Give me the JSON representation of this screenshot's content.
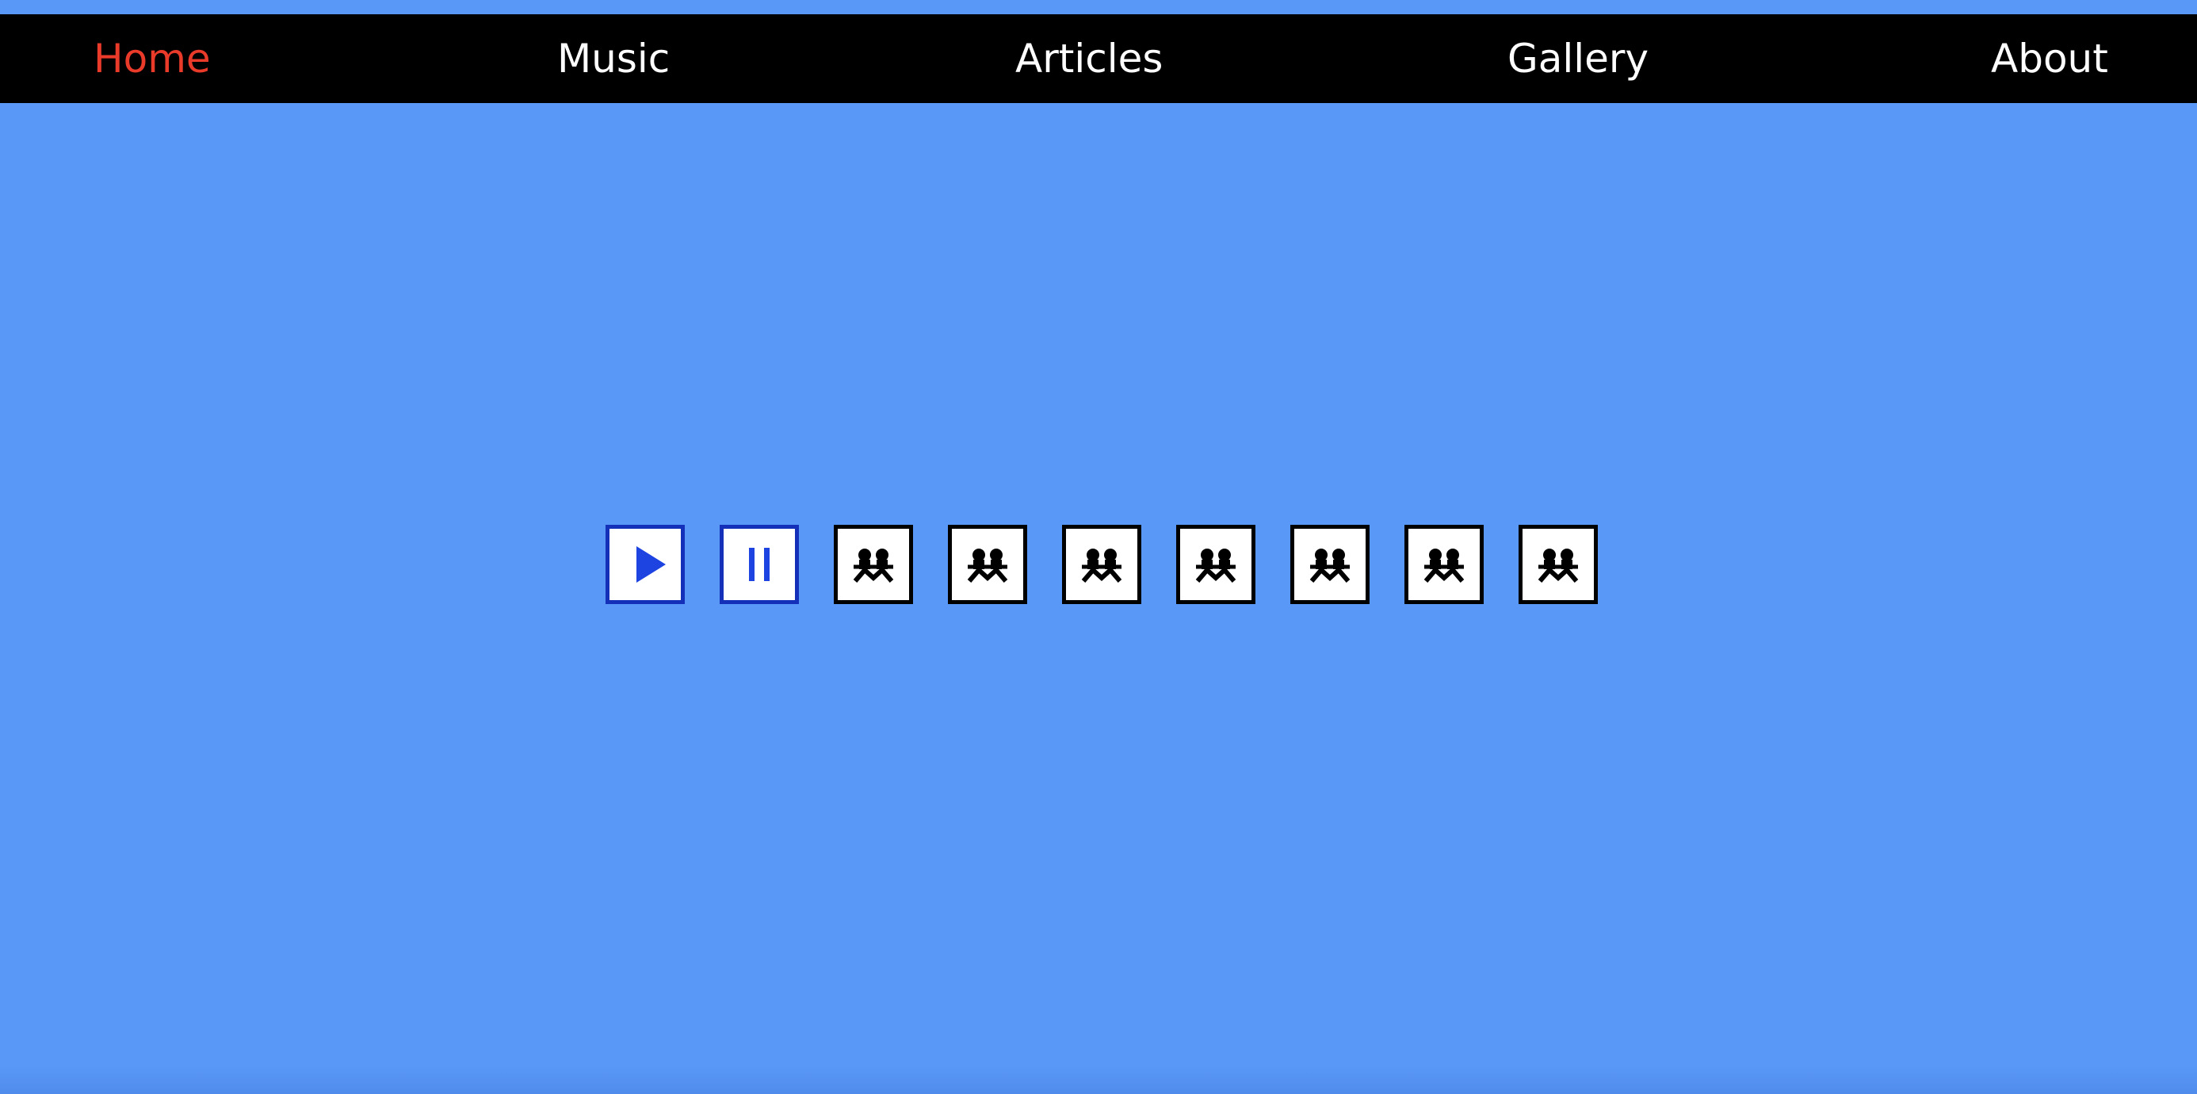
{
  "nav": {
    "items": [
      {
        "label": "Home",
        "active": true
      },
      {
        "label": "Music",
        "active": false
      },
      {
        "label": "Articles",
        "active": false
      },
      {
        "label": "Gallery",
        "active": false
      },
      {
        "label": "About",
        "active": false
      }
    ]
  },
  "colors": {
    "background": "#5a98f8",
    "nav_background": "#000000",
    "nav_text": "#ffffff",
    "nav_active": "#e93a2a",
    "control_blue": "#1530b8",
    "control_icon_blue": "#1d44e0"
  },
  "controls": [
    {
      "icon": "play-icon"
    },
    {
      "icon": "pause-icon"
    },
    {
      "icon": "people-icon"
    },
    {
      "icon": "people-icon"
    },
    {
      "icon": "people-icon"
    },
    {
      "icon": "people-icon"
    },
    {
      "icon": "people-icon"
    },
    {
      "icon": "people-icon"
    },
    {
      "icon": "people-icon"
    }
  ]
}
